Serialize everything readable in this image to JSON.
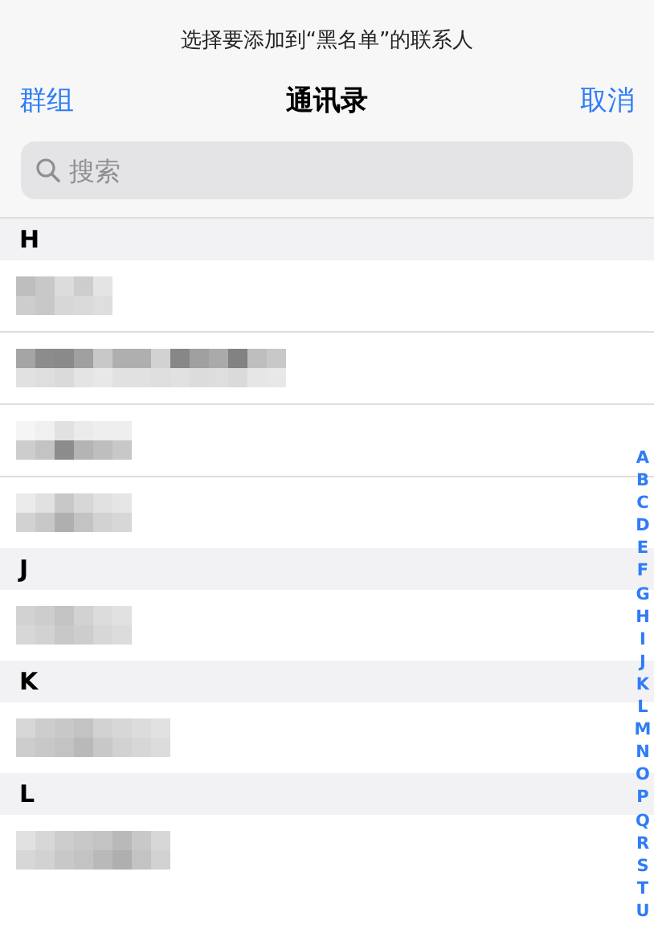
{
  "prompt": "选择要添加到“黑名单”的联系人",
  "nav": {
    "left": "群组",
    "title": "通讯录",
    "right": "取消"
  },
  "search": {
    "placeholder": "搜索"
  },
  "sections": [
    {
      "letter": "H",
      "rows": [
        {
          "kind": "blurred"
        },
        {
          "kind": "blurred"
        },
        {
          "kind": "blurred"
        },
        {
          "kind": "blurred"
        }
      ]
    },
    {
      "letter": "J",
      "rows": [
        {
          "kind": "blurred"
        }
      ]
    },
    {
      "letter": "K",
      "rows": [
        {
          "kind": "blurred"
        }
      ]
    },
    {
      "letter": "L",
      "rows": [
        {
          "kind": "blurred"
        }
      ]
    }
  ],
  "index": [
    "A",
    "B",
    "C",
    "D",
    "E",
    "F",
    "G",
    "H",
    "I",
    "J",
    "K",
    "L",
    "M",
    "N",
    "O",
    "P",
    "Q",
    "R",
    "S",
    "T",
    "U"
  ]
}
